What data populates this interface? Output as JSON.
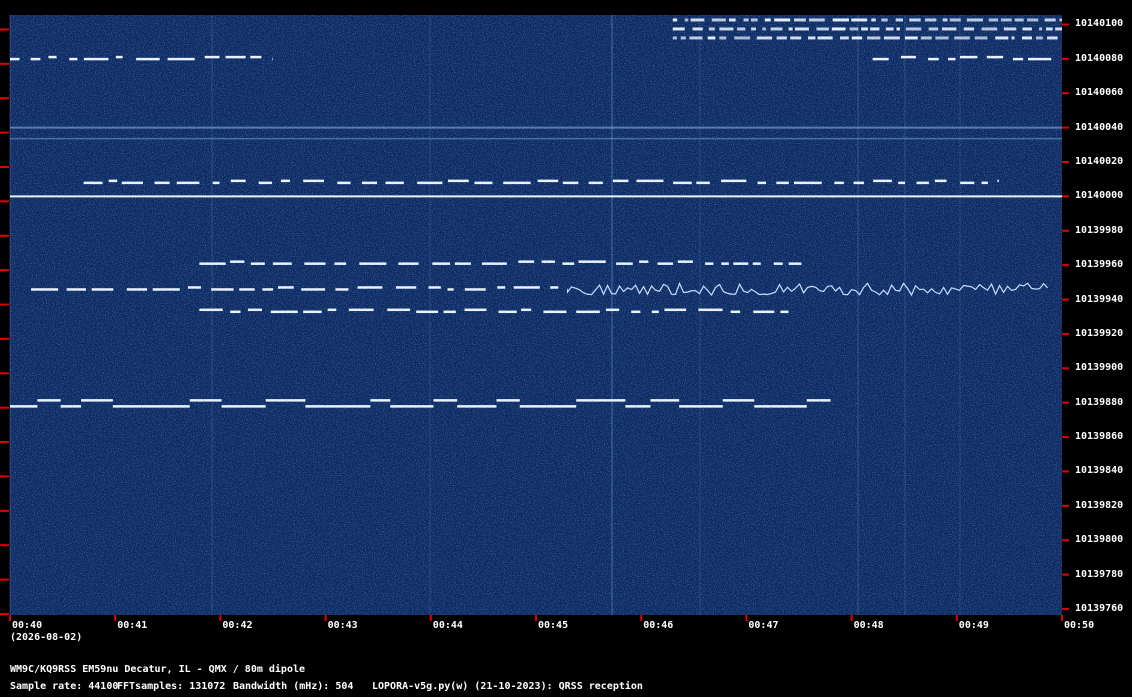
{
  "date_label": "(2026-08-02)",
  "station_line": "WM9C/KQ9RSS EM59nu Decatur, IL - QMX / 80m dipole",
  "params": {
    "sample_rate": "Sample rate: 44100",
    "fft_samples": "FFTsamples: 131072",
    "bandwidth": "Bandwidth (mHz): 504",
    "software": "LOPORA-v5g.py(w) (21-10-2023): QRSS reception"
  },
  "colors": {
    "background": "#000000",
    "waterfall_bg": "#0b2a63",
    "signal": "#e8f2ff",
    "tick": "#e00000"
  },
  "chart_data": {
    "type": "heatmap",
    "title": "",
    "xlabel": "",
    "ylabel": "",
    "x_ticks": [
      "00:40",
      "00:41",
      "00:42",
      "00:43",
      "00:44",
      "00:45",
      "00:46",
      "00:47",
      "00:48",
      "00:49",
      "00:50"
    ],
    "y_ticks": [
      "10140100",
      "10140080",
      "10140060",
      "10140040",
      "10140020",
      "10140000",
      "10139980",
      "10139960",
      "10139940",
      "10139920",
      "10139900",
      "10139880",
      "10139860",
      "10139840",
      "10139820",
      "10139800",
      "10139780",
      "10139760"
    ],
    "signals": [
      {
        "freq": 10140100,
        "t_start": 6.3,
        "t_end": 10.0,
        "style": "dense"
      },
      {
        "freq": 10140080,
        "t_start": 0.0,
        "t_end": 2.5,
        "style": "dashes"
      },
      {
        "freq": 10140080,
        "t_start": 8.2,
        "t_end": 10.0,
        "style": "dashes"
      },
      {
        "freq": 10140040,
        "t_start": 0.0,
        "t_end": 10.0,
        "style": "faint"
      },
      {
        "freq": 10140008,
        "t_start": 0.7,
        "t_end": 9.4,
        "style": "dashes"
      },
      {
        "freq": 10140000,
        "t_start": 0.0,
        "t_end": 10.0,
        "style": "solid"
      },
      {
        "freq": 10139961,
        "t_start": 1.8,
        "t_end": 7.6,
        "style": "dashes"
      },
      {
        "freq": 10139946,
        "t_start": 0.2,
        "t_end": 5.3,
        "style": "dashes"
      },
      {
        "freq": 10139946,
        "t_start": 5.3,
        "t_end": 9.9,
        "style": "wavy"
      },
      {
        "freq": 10139933,
        "t_start": 1.8,
        "t_end": 7.4,
        "style": "dashes"
      },
      {
        "freq": 10139878,
        "t_start": 0.0,
        "t_end": 7.8,
        "style": "fsk"
      }
    ]
  }
}
